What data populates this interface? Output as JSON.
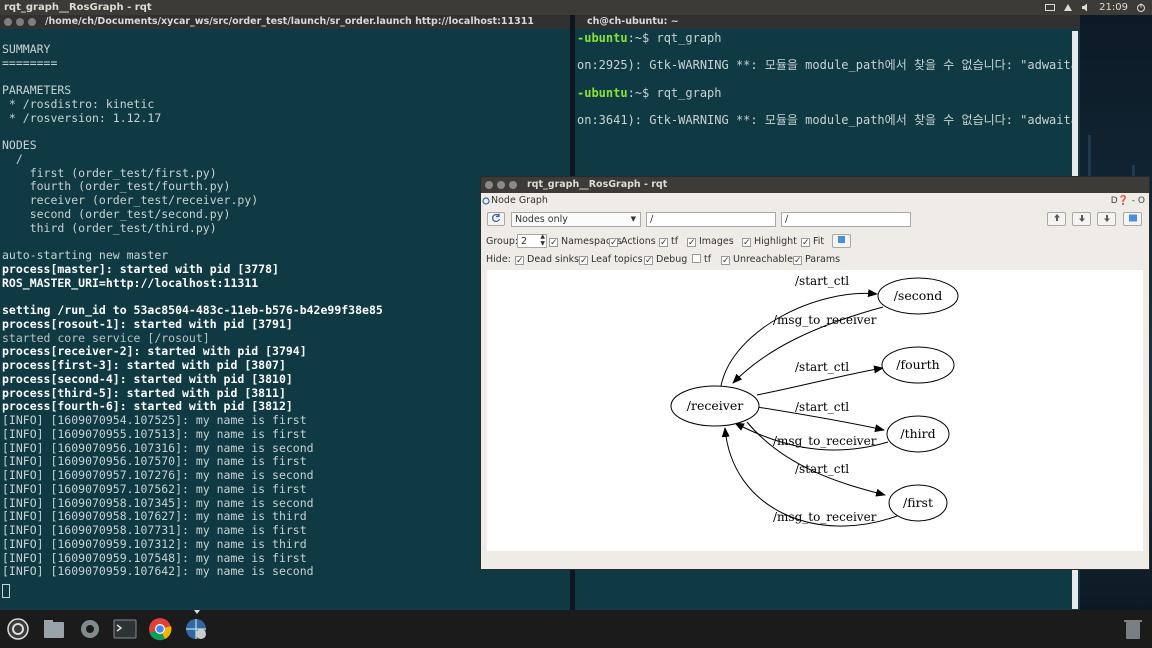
{
  "top_panel": {
    "title": "rqt_graph__RosGraph - rqt",
    "clock": "21:09"
  },
  "term_left": {
    "title": "/home/ch/Documents/xycar_ws/src/order_test/launch/sr_order.launch http://localhost:11311",
    "lines": [
      {
        "text": "",
        "style": ""
      },
      {
        "text": "SUMMARY",
        "style": ""
      },
      {
        "text": "========",
        "style": ""
      },
      {
        "text": "",
        "style": ""
      },
      {
        "text": "PARAMETERS",
        "style": ""
      },
      {
        "text": " * /rosdistro: kinetic",
        "style": ""
      },
      {
        "text": " * /rosversion: 1.12.17",
        "style": ""
      },
      {
        "text": "",
        "style": ""
      },
      {
        "text": "NODES",
        "style": ""
      },
      {
        "text": "  /",
        "style": ""
      },
      {
        "text": "    first (order_test/first.py)",
        "style": ""
      },
      {
        "text": "    fourth (order_test/fourth.py)",
        "style": ""
      },
      {
        "text": "    receiver (order_test/receiver.py)",
        "style": ""
      },
      {
        "text": "    second (order_test/second.py)",
        "style": ""
      },
      {
        "text": "    third (order_test/third.py)",
        "style": ""
      },
      {
        "text": "",
        "style": ""
      },
      {
        "text": "auto-starting new master",
        "style": ""
      },
      {
        "text": "process[master]: started with pid [3778]",
        "style": "b"
      },
      {
        "text": "ROS_MASTER_URI=http://localhost:11311",
        "style": "b"
      },
      {
        "text": "",
        "style": ""
      },
      {
        "text": "setting /run_id to 53ac8504-483c-11eb-b576-b42e99f38e85",
        "style": "b"
      },
      {
        "text": "process[rosout-1]: started with pid [3791]",
        "style": "b"
      },
      {
        "text": "started core service [/rosout]",
        "style": "dim"
      },
      {
        "text": "process[receiver-2]: started with pid [3794]",
        "style": "b"
      },
      {
        "text": "process[first-3]: started with pid [3807]",
        "style": "b"
      },
      {
        "text": "process[second-4]: started with pid [3810]",
        "style": "b"
      },
      {
        "text": "process[third-5]: started with pid [3811]",
        "style": "b"
      },
      {
        "text": "process[fourth-6]: started with pid [3812]",
        "style": "b"
      },
      {
        "text": "[INFO] [1609070954.107525]: my name is first",
        "style": ""
      },
      {
        "text": "[INFO] [1609070955.107513]: my name is first",
        "style": ""
      },
      {
        "text": "[INFO] [1609070956.107316]: my name is second",
        "style": ""
      },
      {
        "text": "[INFO] [1609070956.107570]: my name is first",
        "style": ""
      },
      {
        "text": "[INFO] [1609070957.107276]: my name is second",
        "style": ""
      },
      {
        "text": "[INFO] [1609070957.107562]: my name is first",
        "style": ""
      },
      {
        "text": "[INFO] [1609070958.107345]: my name is second",
        "style": ""
      },
      {
        "text": "[INFO] [1609070958.107627]: my name is third",
        "style": ""
      },
      {
        "text": "[INFO] [1609070958.107731]: my name is first",
        "style": ""
      },
      {
        "text": "[INFO] [1609070959.107312]: my name is third",
        "style": ""
      },
      {
        "text": "[INFO] [1609070959.107548]: my name is first",
        "style": ""
      },
      {
        "text": "[INFO] [1609070959.107642]: my name is second",
        "style": ""
      }
    ]
  },
  "term_right": {
    "title": "ch@ch-ubuntu: ~",
    "prompt1": "-ubuntu",
    "cmd1": ":~$ rqt_graph",
    "warn1": "on:2925): Gtk-WARNING **: 모듈을 module_path에서 찾을 수 없습니다: \"adwaita",
    "prompt2": "-ubuntu",
    "cmd2": ":~$ rqt_graph",
    "warn2": "on:3641): Gtk-WARNING **: 모듈을 module_path에서 찾을 수 없습니다: \"adwaita"
  },
  "rqt": {
    "title": "rqt_graph__RosGraph - rqt",
    "plugin_label": "Node Graph",
    "plugin_controls": "D❓ - O",
    "mode": "Nodes only",
    "filter1": "/",
    "filter2": "/",
    "group_label": "Group:",
    "group_value": "2",
    "namespaces": "Namespaces",
    "actions": "Actions",
    "tf": "tf",
    "images": "Images",
    "highlight": "Highlight",
    "fit": "Fit",
    "hide_label": "Hide:",
    "dead_sinks": "Dead sinks",
    "leaf_topics": "Leaf topics",
    "debug": "Debug",
    "tf2": "tf",
    "unreachable": "Unreachable",
    "params": "Params"
  },
  "graph": {
    "nodes": {
      "receiver": "/receiver",
      "second": "/second",
      "fourth": "/fourth",
      "third": "/third",
      "first": "/first"
    },
    "edges": {
      "e1": "/start_ctl",
      "e2": "/msg_to_receiver",
      "e3": "/start_ctl",
      "e4": "/start_ctl",
      "e5": "/msg_to_receiver",
      "e6": "/start_ctl",
      "e7": "/msg_to_receiver"
    }
  }
}
